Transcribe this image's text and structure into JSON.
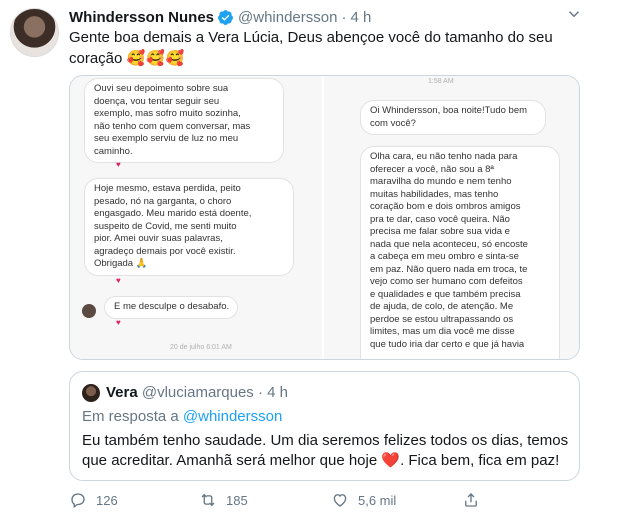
{
  "tweet": {
    "name": "Whindersson Nunes",
    "handle": "@whindersson",
    "dot": "·",
    "time": "4 h",
    "text": "Gente boa demais a Vera Lúcia, Deus abençoe você do tamanho do seu coração",
    "emojis": "🥰🥰🥰"
  },
  "media": {
    "left": {
      "bubble1": [
        "Ouvi seu depoimento sobre sua",
        "doença, vou tentar seguir seu",
        "exemplo, mas sofro muito sozinha,",
        "não tenho com quem conversar, mas",
        "seu exemplo serviu de luz no meu",
        "caminho."
      ],
      "bubble2": [
        "Hoje mesmo, estava perdida, peito",
        "pesado, nó na garganta, o choro",
        "engasgado. Meu marido está doente,",
        "suspeito de Covid, me senti muito",
        "pior. Amei ouvir suas palavras,",
        "agradeço demais por você existir.",
        "Obrigada 🙏"
      ],
      "bubble3": "E me desculpe o desabafo.",
      "timestamp": "20 de julho 6:01 AM",
      "heart": "♥"
    },
    "right": {
      "timestamp": "1:58 AM",
      "bubble1": [
        "Oi Whindersson, boa noite!Tudo bem",
        "com você?"
      ],
      "bubble2": [
        "Olha cara, eu não tenho nada para",
        "oferecer a você, não sou a 8ª",
        "maravilha do mundo e nem tenho",
        "muitas habilidades, mas tenho",
        "coração bom e dois ombros amigos",
        "pra te dar, caso você queira. Não",
        "precisa me falar sobre sua vida e",
        "nada que nela aconteceu, só encoste",
        "a cabeça em meu ombro e sinta-se",
        "em paz. Não quero nada em troca, te",
        "vejo como ser humano com defeitos",
        "e qualidades e que também precisa",
        "de ajuda, de colo, de atenção. Me",
        "perdoe se estou ultrapassando os",
        "limites, mas um dia você me disse",
        "que tudo iria dar certo e que já havia"
      ]
    }
  },
  "quote": {
    "name": "Vera",
    "handle": "@vluciamarques",
    "dot": "·",
    "time": "4 h",
    "reply_prefix": "Em resposta a",
    "reply_to": "@whindersson",
    "text_line1": "Eu também tenho saudade. Um dia seremos felizes todos os dias, temos",
    "text_line2a": "que acreditar. Amanhã será melhor que hoje",
    "heart": "❤️",
    "text_line2b": ". Fica bem, fica em paz!"
  },
  "actions": {
    "replies": "126",
    "retweets": "185",
    "likes": "5,6 mil"
  },
  "colors": {
    "accent": "#1da1f2",
    "muted": "#657786",
    "heart": "#e0245e"
  }
}
